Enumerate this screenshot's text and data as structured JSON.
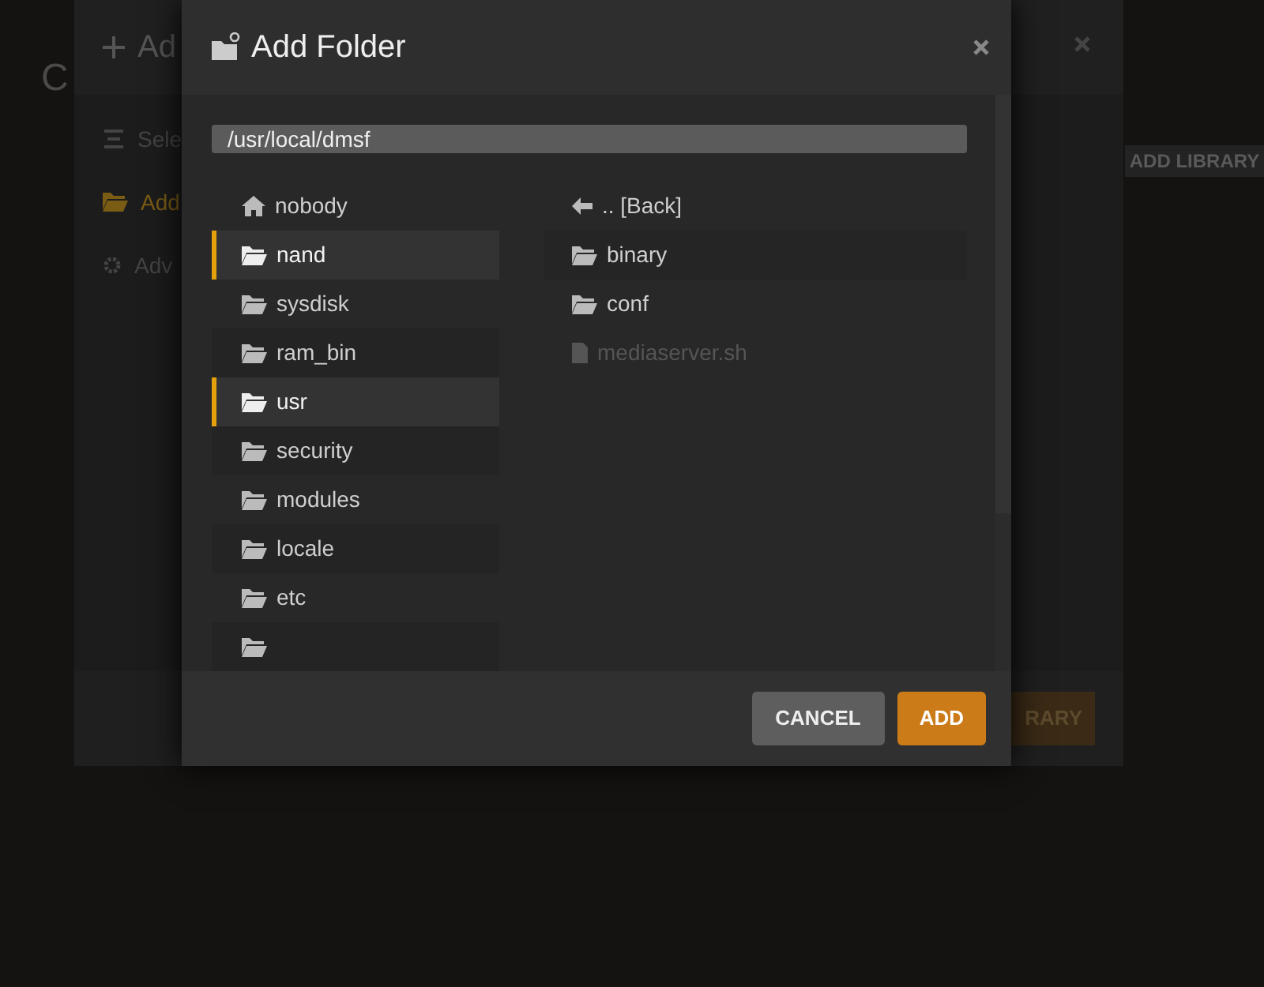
{
  "background_page": {
    "heading": "C",
    "add_library_button": "ADD LIBRARY"
  },
  "library_dialog": {
    "title": "Ad",
    "sidebar": [
      {
        "label": "Sele",
        "selected": false,
        "kind": "list"
      },
      {
        "label": "Add",
        "selected": true,
        "kind": "folder"
      },
      {
        "label": "Adv",
        "selected": false,
        "kind": "gear"
      }
    ],
    "footer_button": "RARY"
  },
  "folder_dialog": {
    "title": "Add Folder",
    "path": "/usr/local/dmsf",
    "directories": [
      {
        "label": "nobody",
        "kind": "home",
        "selected": false
      },
      {
        "label": "nand",
        "kind": "folder",
        "selected": true
      },
      {
        "label": "sysdisk",
        "kind": "folder",
        "selected": false
      },
      {
        "label": "ram_bin",
        "kind": "folder",
        "selected": false
      },
      {
        "label": "usr",
        "kind": "folder",
        "selected": true
      },
      {
        "label": "security",
        "kind": "folder",
        "selected": false
      },
      {
        "label": "modules",
        "kind": "folder",
        "selected": false
      },
      {
        "label": "locale",
        "kind": "folder",
        "selected": false
      },
      {
        "label": "etc",
        "kind": "folder",
        "selected": false
      },
      {
        "kind": "folder",
        "selected": false
      }
    ],
    "contents": [
      {
        "label": ".. [Back]",
        "kind": "back"
      },
      {
        "label": "binary",
        "kind": "folder"
      },
      {
        "label": "conf",
        "kind": "folder"
      },
      {
        "label": "mediaserver.sh",
        "kind": "file"
      }
    ],
    "buttons": [
      {
        "label": "CANCEL",
        "kind": "secondary"
      },
      {
        "label": "ADD",
        "kind": "primary"
      }
    ]
  }
}
